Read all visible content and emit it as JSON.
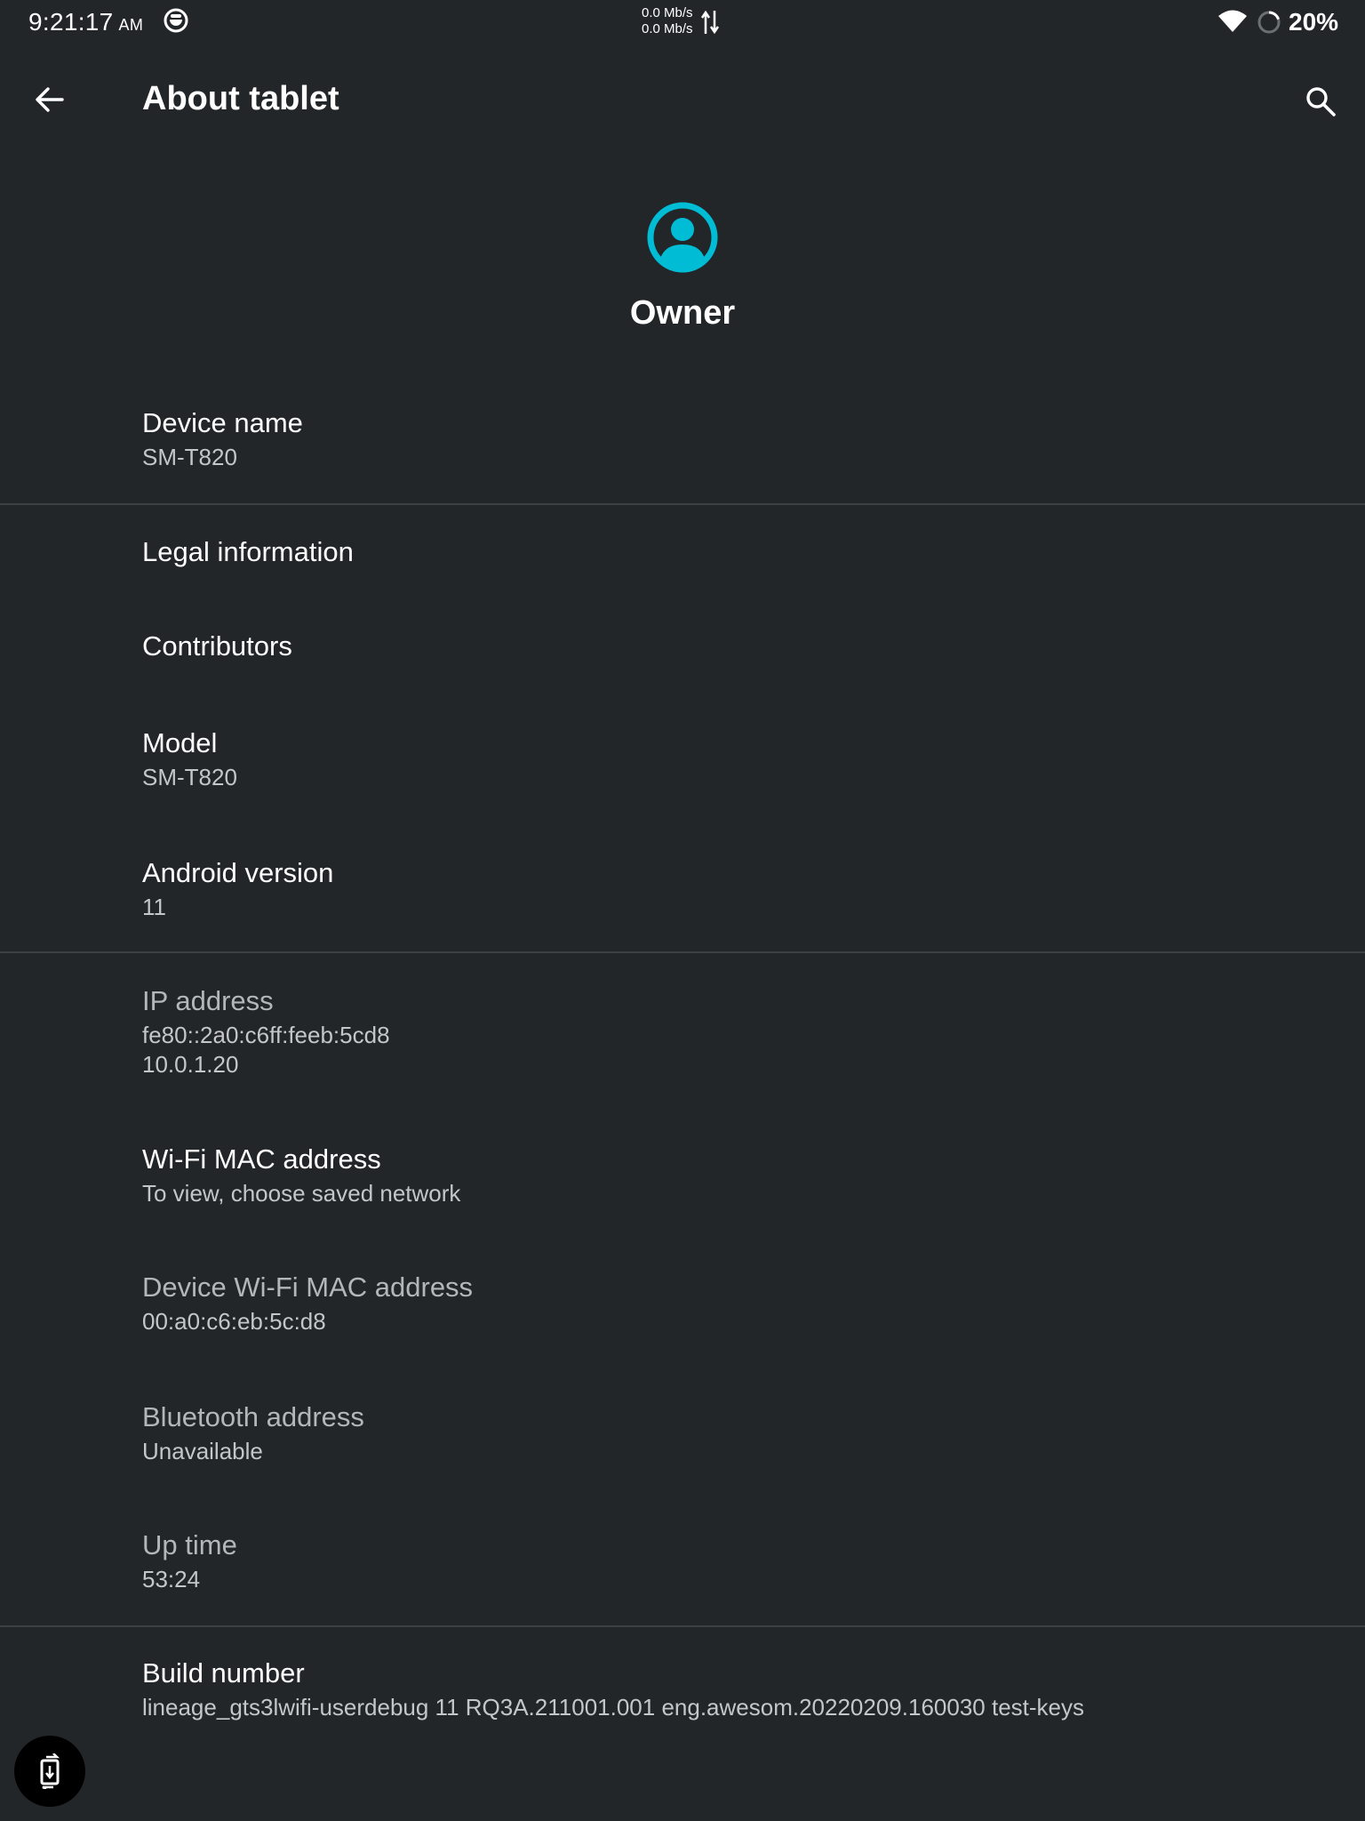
{
  "status_bar": {
    "time": "9:21:17",
    "am_pm": "AM",
    "net_up": "0.0 Mb/s",
    "net_down": "0.0 Mb/s",
    "battery_percent": "20%"
  },
  "toolbar": {
    "title": "About tablet"
  },
  "owner": {
    "name": "Owner",
    "accent_color": "#00bcd4"
  },
  "items": [
    {
      "title": "Device name",
      "summary": "SM-T820"
    },
    {
      "title": "Legal information"
    },
    {
      "title": "Contributors"
    },
    {
      "title": "Model",
      "summary": "SM-T820"
    },
    {
      "title": "Android version",
      "summary": "11"
    },
    {
      "title": "IP address",
      "summary_line1": "fe80::2a0:c6ff:feeb:5cd8",
      "summary_line2": "10.0.1.20"
    },
    {
      "title": "Wi-Fi MAC address",
      "summary": "To view, choose saved network"
    },
    {
      "title": "Device Wi-Fi MAC address",
      "summary": "00:a0:c6:eb:5c:d8"
    },
    {
      "title": "Bluetooth address",
      "summary": "Unavailable"
    },
    {
      "title": "Up time",
      "summary": "53:24"
    },
    {
      "title": "Build number",
      "summary": "lineage_gts3lwifi-userdebug 11 RQ3A.211001.001 eng.awesom.20220209.160030 test-keys"
    }
  ],
  "colors": {
    "background": "#222629",
    "divider": "#3c4044",
    "text_primary": "#ffffff",
    "text_secondary": "#c4c7c9"
  }
}
